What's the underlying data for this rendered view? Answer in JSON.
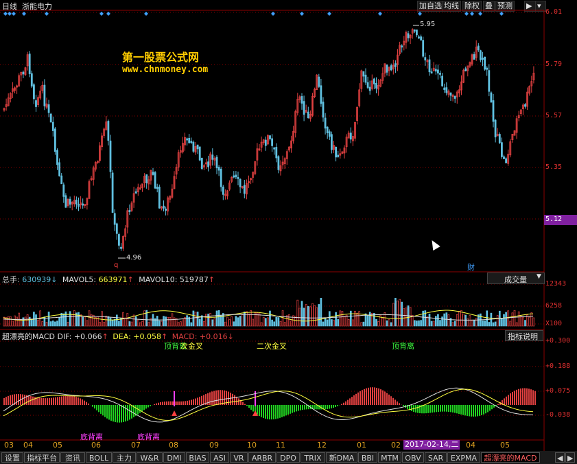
{
  "header": {
    "period": "日线",
    "stock_name": "浙能电力",
    "buttons": [
      "加自选",
      "均线",
      "除权",
      "叠",
      "预测"
    ]
  },
  "watermark": {
    "line1": "第一股票公式网",
    "line2": "www.chnmoney.com"
  },
  "price_panel": {
    "y_labels": [
      "6.01",
      "5.79",
      "5.57",
      "5.35",
      "5.12"
    ],
    "current_price": "5.12",
    "high_label": "5.95",
    "low_label": "4.96",
    "marker_q": "q",
    "marker_cai": "财"
  },
  "volume_panel": {
    "total_label": "总手: ",
    "total_value": "630939",
    "mavol5_label": "MAVOL5: ",
    "mavol5_value": "663971",
    "mavol10_label": "MAVOL10: ",
    "mavol10_value": "519787",
    "indicator_select": "成交量",
    "y_labels": [
      "12343",
      "6258",
      "X100"
    ]
  },
  "macd_panel": {
    "title": "超漂亮的MACD",
    "dif_label": "DIF: ",
    "dif_value": "+0.066",
    "dea_label": "DEA: ",
    "dea_value": "+0.058",
    "macd_label": "MACD: ",
    "macd_value": "+0.016",
    "help_button": "指标说明",
    "y_labels": [
      "+0.300",
      "+0.188",
      "+0.075",
      "-0.038"
    ],
    "annotations": {
      "top1": "顶背离",
      "top2": "次金叉",
      "second_cross": "二次金叉",
      "top3": "顶背离",
      "bottom1": "底背离",
      "bottom2": "底背离"
    }
  },
  "x_axis": {
    "labels": [
      "03",
      "04",
      "05",
      "06",
      "07",
      "08",
      "09",
      "10",
      "11",
      "12",
      "01",
      "02",
      "04",
      "05"
    ],
    "highlight": "2017-02-14,二"
  },
  "tabs": [
    "设置",
    "指标平台",
    "资讯",
    "BOLL",
    "主力",
    "W&R",
    "DMI",
    "BIAS",
    "ASI",
    "VR",
    "ARBR",
    "DPO",
    "TRIX",
    "新DMA",
    "BBI",
    "MTM",
    "OBV",
    "SAR",
    "EXPMA",
    "超漂亮的MACD"
  ],
  "colors": {
    "up": "#e04040",
    "down": "#60c0e0",
    "grid": "#8b0000",
    "watermark": "#ffcc00"
  }
}
